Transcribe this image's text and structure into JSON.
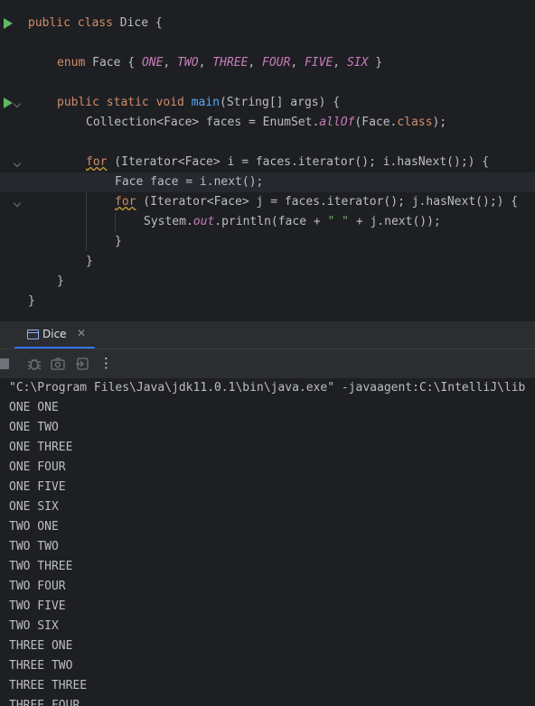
{
  "editor": {
    "line1": {
      "kw": "public class",
      "name": "Dice",
      "brace": "{"
    },
    "line3": {
      "kw": "enum",
      "name": "Face",
      "open": "{",
      "c1": "ONE",
      "c2": "TWO",
      "c3": "THREE",
      "c4": "FOUR",
      "c5": "FIVE",
      "c6": "SIX",
      "close": "}",
      "comma": ","
    },
    "line5": {
      "kw": "public static void",
      "fn": "main",
      "rest": "(String[] args) {"
    },
    "line6": {
      "pre": "Collection<Face> faces = EnumSet.",
      "st": "allOf",
      "mid": "(Face.",
      "kw": "class",
      "post": ");"
    },
    "line8": {
      "kw": "for",
      "rest": " (Iterator<Face> i = faces.iterator(); i.hasNext();) {"
    },
    "line9": {
      "text": "Face face = i.next();"
    },
    "line10": {
      "kw": "for",
      "rest": " (Iterator<Face> j = faces.iterator(); j.hasNext();) {"
    },
    "line11": {
      "pre": "System.",
      "st": "out",
      "mid": ".println(face + ",
      "str": "\" \"",
      "post": " + j.next());"
    },
    "close_brace": "}"
  },
  "run_tab": {
    "label": "Dice",
    "close": "✕"
  },
  "toolbar": {
    "icons": [
      "stop-icon",
      "debug-icon",
      "camera-icon",
      "exit-icon",
      "more-icon"
    ],
    "more_label": "⋮"
  },
  "console": {
    "command": "\"C:\\Program Files\\Java\\jdk11.0.1\\bin\\java.exe\" -javaagent:C:\\IntelliJ\\lib",
    "output": [
      "ONE ONE",
      "ONE TWO",
      "ONE THREE",
      "ONE FOUR",
      "ONE FIVE",
      "ONE SIX",
      "TWO ONE",
      "TWO TWO",
      "TWO THREE",
      "TWO FOUR",
      "TWO FIVE",
      "TWO SIX",
      "THREE ONE",
      "THREE TWO",
      "THREE THREE",
      "THREE FOUR"
    ]
  },
  "colors": {
    "background": "#1e1f22",
    "keyword": "#cf8e6d",
    "function": "#56a8f5",
    "constant": "#c77dbb",
    "string": "#6aab73",
    "accent": "#3574f0",
    "run": "#5fb865"
  }
}
